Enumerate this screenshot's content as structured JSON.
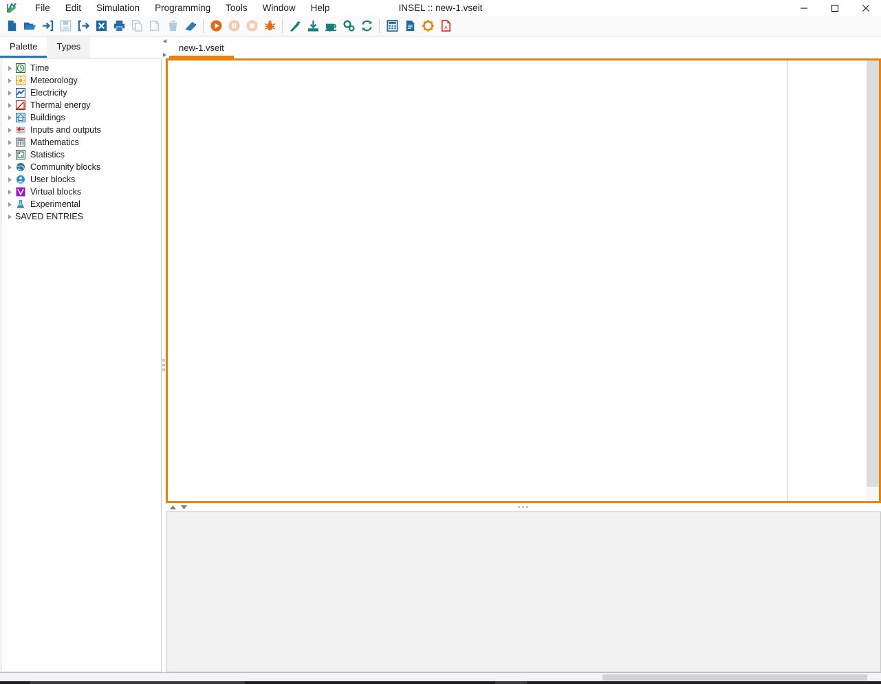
{
  "window": {
    "title": "INSEL :: new-1.vseit",
    "logo_icon": "insel-logo-icon",
    "controls": [
      {
        "name": "minimize-button",
        "glyph": "–"
      },
      {
        "name": "maximize-button",
        "glyph": "□"
      },
      {
        "name": "close-button",
        "glyph": "✕"
      }
    ]
  },
  "menubar": {
    "items": [
      {
        "label": "File"
      },
      {
        "label": "Edit"
      },
      {
        "label": "Simulation"
      },
      {
        "label": "Programming"
      },
      {
        "label": "Tools"
      },
      {
        "label": "Window"
      },
      {
        "label": "Help"
      }
    ]
  },
  "toolbar": {
    "groups": [
      {
        "buttons": [
          {
            "name": "new-file-icon",
            "label": "New",
            "enabled": true
          },
          {
            "name": "open-folder-icon",
            "label": "Open",
            "enabled": true
          },
          {
            "name": "import-icon",
            "label": "Import",
            "enabled": true
          },
          {
            "name": "save-icon",
            "label": "Save",
            "enabled": false
          },
          {
            "name": "export-icon",
            "label": "Export",
            "enabled": true
          },
          {
            "name": "close-document-icon",
            "label": "Close",
            "enabled": true
          },
          {
            "name": "print-icon",
            "label": "Print",
            "enabled": true
          },
          {
            "name": "copy-icon",
            "label": "Copy",
            "enabled": false
          },
          {
            "name": "paste-icon",
            "label": "Paste",
            "enabled": false
          },
          {
            "name": "delete-icon",
            "label": "Delete",
            "enabled": false
          },
          {
            "name": "eraser-icon",
            "label": "Clear",
            "enabled": true
          }
        ]
      },
      {
        "buttons": [
          {
            "name": "run-icon",
            "label": "Run",
            "enabled": true
          },
          {
            "name": "pause-icon",
            "label": "Pause",
            "enabled": false
          },
          {
            "name": "stop-icon",
            "label": "Stop",
            "enabled": false
          },
          {
            "name": "debug-icon",
            "label": "Debug",
            "enabled": true
          }
        ]
      },
      {
        "buttons": [
          {
            "name": "wand-icon",
            "label": "Wizard",
            "enabled": true
          },
          {
            "name": "download-icon",
            "label": "Download",
            "enabled": true
          },
          {
            "name": "coffee-icon",
            "label": "Java",
            "enabled": true
          },
          {
            "name": "gears-icon",
            "label": "Settings",
            "enabled": true
          },
          {
            "name": "refresh-icon",
            "label": "Refresh",
            "enabled": true
          }
        ]
      },
      {
        "buttons": [
          {
            "name": "calculator-icon",
            "label": "Calculator",
            "enabled": true
          },
          {
            "name": "document-icon",
            "label": "Report",
            "enabled": true
          },
          {
            "name": "sun-gear-icon",
            "label": "Options",
            "enabled": true
          },
          {
            "name": "pdf-icon",
            "label": "PDF",
            "enabled": true
          }
        ]
      }
    ]
  },
  "left_panel": {
    "tabs": [
      {
        "label": "Palette",
        "active": true
      },
      {
        "label": "Types",
        "active": false
      }
    ],
    "tree": [
      {
        "label": "Time",
        "icon": "clock-icon"
      },
      {
        "label": "Meteorology",
        "icon": "sun-icon"
      },
      {
        "label": "Electricity",
        "icon": "zigzag-icon"
      },
      {
        "label": "Thermal energy",
        "icon": "thermal-icon"
      },
      {
        "label": "Buildings",
        "icon": "house-icon"
      },
      {
        "label": "Inputs and outputs",
        "icon": "arrow-in-out-icon"
      },
      {
        "label": "Mathematics",
        "icon": "calculator-small-icon"
      },
      {
        "label": "Statistics",
        "icon": "dice-icon"
      },
      {
        "label": "Community blocks",
        "icon": "globe-icon"
      },
      {
        "label": "User blocks",
        "icon": "user-icon"
      },
      {
        "label": "Virtual blocks",
        "icon": "virtual-v-icon"
      },
      {
        "label": "Experimental",
        "icon": "flask-icon"
      },
      {
        "label": "SAVED ENTRIES",
        "icon": ""
      }
    ]
  },
  "editor": {
    "tabs": [
      {
        "label": "new-1.vseit",
        "active": true
      }
    ],
    "scroll_arrow_up": "triangle-left-icon",
    "scroll_arrow_down": "triangle-right-icon",
    "canvas_content": ""
  },
  "splitter": {
    "collapse_up_icon": "triangle-up-icon",
    "collapse_down_icon": "triangle-down-icon",
    "grip_icon": "grip-dots-icon"
  },
  "bottom_panel": {
    "content": ""
  },
  "colors": {
    "accent_orange": "#e8820c",
    "accent_blue": "#2e75b6",
    "icon_blue": "#1f6aa5",
    "icon_teal": "#1a7f7a",
    "icon_red": "#d92b2b"
  }
}
